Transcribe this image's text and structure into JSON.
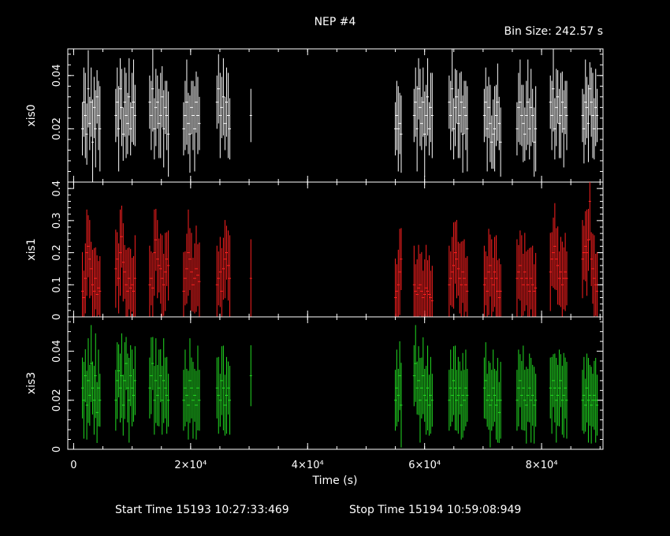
{
  "header": {
    "title": "NEP #4",
    "bin_size": "Bin Size: 242.57 s"
  },
  "footer": {
    "start_time": "Start Time 15193 10:27:33:469",
    "stop_time": "Stop Time 15194 10:59:08:949"
  },
  "colors": {
    "background": "#000000",
    "axes": "#ffffff",
    "xis0": "#ffffff",
    "xis1": "#ff2020",
    "xis3": "#22dd22"
  },
  "chart_data": {
    "type": "scatter",
    "style": "error-bar light curves, three stacked panels sharing x axis",
    "xlabel": "Time (s)",
    "xlim": [
      -1000,
      90500
    ],
    "x_ticks": [
      0,
      20000,
      40000,
      60000,
      80000
    ],
    "x_tick_labels": [
      "0",
      "2×10⁴",
      "4×10⁴",
      "6×10⁴",
      "8×10⁴"
    ],
    "panels": [
      {
        "name": "xis0",
        "ylabel": "xis0",
        "color": "#ffffff",
        "ylim": [
          0,
          0.05
        ],
        "y_ticks": [
          0.02,
          0.04
        ],
        "y_tick_labels": [
          "0.02",
          "0.04"
        ],
        "segments": [
          {
            "start": 1500,
            "end": 4500,
            "values": [
              0.02,
              0.03,
              0.025,
              0.018,
              0.035,
              0.022,
              0.03,
              0.015,
              0.028,
              0.02,
              0.032,
              0.025,
              0.02
            ]
          },
          {
            "start": 7200,
            "end": 10500,
            "values": [
              0.025,
              0.03,
              0.02,
              0.035,
              0.028,
              0.018,
              0.03,
              0.025,
              0.022,
              0.032,
              0.02,
              0.028,
              0.03,
              0.025
            ]
          },
          {
            "start": 13000,
            "end": 16200,
            "values": [
              0.03,
              0.025,
              0.035,
              0.02,
              0.028,
              0.03,
              0.022,
              0.025,
              0.032,
              0.02,
              0.028,
              0.025,
              0.018
            ]
          },
          {
            "start": 18800,
            "end": 21500,
            "values": [
              0.02,
              0.025,
              0.03,
              0.022,
              0.018,
              0.028,
              0.025,
              0.02,
              0.03,
              0.025,
              0.022
            ]
          },
          {
            "start": 24500,
            "end": 26700,
            "values": [
              0.03,
              0.035,
              0.025,
              0.028,
              0.032,
              0.022,
              0.03,
              0.025,
              0.02
            ]
          },
          {
            "start": 30300,
            "end": 30300,
            "values": [
              0.025
            ]
          },
          {
            "start": 55000,
            "end": 56000,
            "values": [
              0.02,
              0.025,
              0.02,
              0.022,
              0.018
            ]
          },
          {
            "start": 58200,
            "end": 61300,
            "values": [
              0.025,
              0.03,
              0.02,
              0.035,
              0.028,
              0.022,
              0.03,
              0.018,
              0.025,
              0.032,
              0.02,
              0.028,
              0.025
            ]
          },
          {
            "start": 64200,
            "end": 67300,
            "values": [
              0.03,
              0.025,
              0.035,
              0.02,
              0.028,
              0.032,
              0.022,
              0.025,
              0.03,
              0.018,
              0.028,
              0.025,
              0.02
            ]
          },
          {
            "start": 70200,
            "end": 73000,
            "values": [
              0.025,
              0.03,
              0.02,
              0.028,
              0.022,
              0.015,
              0.018,
              0.02,
              0.025,
              0.03,
              0.022,
              0.015
            ]
          },
          {
            "start": 75800,
            "end": 79000,
            "values": [
              0.02,
              0.028,
              0.03,
              0.025,
              0.022,
              0.018,
              0.025,
              0.03,
              0.02,
              0.028,
              0.025,
              0.015,
              0.02
            ]
          },
          {
            "start": 81500,
            "end": 84300,
            "values": [
              0.03,
              0.025,
              0.035,
              0.02,
              0.028,
              0.032,
              0.022,
              0.025,
              0.03,
              0.02,
              0.028,
              0.025
            ]
          },
          {
            "start": 87000,
            "end": 89500,
            "values": [
              0.025,
              0.02,
              0.03,
              0.028,
              0.022,
              0.035,
              0.03,
              0.025,
              0.02,
              0.028,
              0.025
            ]
          }
        ]
      },
      {
        "name": "xis1",
        "ylabel": "xis1",
        "color": "#ff2020",
        "ylim": [
          0,
          0.42
        ],
        "y_ticks": [
          0,
          0.1,
          0.2,
          0.3,
          0.4
        ],
        "y_tick_labels": [
          "0",
          "0.1",
          "0.2",
          "0.3",
          "0.4"
        ],
        "segments": [
          {
            "start": 1500,
            "end": 4500,
            "values": [
              0.08,
              0.06,
              0.12,
              0.2,
              0.22,
              0.18,
              0.15,
              0.1,
              0.08,
              0.12,
              0.07,
              0.09,
              0.08
            ]
          },
          {
            "start": 7200,
            "end": 10500,
            "values": [
              0.15,
              0.18,
              0.12,
              0.2,
              0.25,
              0.17,
              0.14,
              0.1,
              0.08,
              0.12,
              0.09,
              0.1,
              0.08,
              0.12
            ]
          },
          {
            "start": 13000,
            "end": 16200,
            "values": [
              0.1,
              0.12,
              0.09,
              0.2,
              0.24,
              0.18,
              0.16,
              0.15,
              0.12,
              0.1,
              0.14,
              0.18,
              0.16
            ]
          },
          {
            "start": 18800,
            "end": 21500,
            "values": [
              0.08,
              0.12,
              0.15,
              0.2,
              0.18,
              0.14,
              0.1,
              0.12,
              0.15,
              0.13,
              0.11
            ]
          },
          {
            "start": 24500,
            "end": 26700,
            "values": [
              0.1,
              0.12,
              0.14,
              0.08,
              0.15,
              0.18,
              0.2,
              0.16,
              0.12
            ]
          },
          {
            "start": 30300,
            "end": 30300,
            "values": [
              0.12
            ]
          },
          {
            "start": 55000,
            "end": 56000,
            "values": [
              0.06,
              0.08,
              0.1,
              0.14,
              0.18
            ]
          },
          {
            "start": 58200,
            "end": 61300,
            "values": [
              0.1,
              0.08,
              0.07,
              0.09,
              0.1,
              0.08,
              0.06,
              0.07,
              0.09,
              0.08,
              0.07,
              0.06,
              0.05
            ]
          },
          {
            "start": 64200,
            "end": 67300,
            "values": [
              0.1,
              0.12,
              0.14,
              0.16,
              0.2,
              0.18,
              0.15,
              0.12,
              0.1,
              0.14,
              0.12,
              0.1,
              0.08
            ]
          },
          {
            "start": 70200,
            "end": 73000,
            "values": [
              0.1,
              0.12,
              0.08,
              0.14,
              0.16,
              0.12,
              0.1,
              0.14,
              0.12,
              0.08,
              0.06,
              0.08
            ]
          },
          {
            "start": 75800,
            "end": 79000,
            "values": [
              0.12,
              0.14,
              0.16,
              0.12,
              0.1,
              0.14,
              0.12,
              0.1,
              0.08,
              0.12,
              0.1,
              0.08,
              0.09
            ]
          },
          {
            "start": 81500,
            "end": 84300,
            "values": [
              0.14,
              0.18,
              0.2,
              0.22,
              0.18,
              0.16,
              0.12,
              0.14,
              0.1,
              0.12,
              0.14,
              0.12
            ]
          },
          {
            "start": 87000,
            "end": 89500,
            "values": [
              0.18,
              0.2,
              0.22,
              0.2,
              0.24,
              0.36,
              0.18,
              0.15,
              0.12,
              0.1,
              0.08
            ]
          }
        ]
      },
      {
        "name": "xis3",
        "ylabel": "xis3",
        "color": "#22dd22",
        "ylim": [
          0,
          0.054
        ],
        "y_ticks": [
          0,
          0.02,
          0.04
        ],
        "y_tick_labels": [
          "0",
          "0.02",
          "0.04"
        ],
        "segments": [
          {
            "start": 1500,
            "end": 4500,
            "values": [
              0.025,
              0.02,
              0.03,
              0.018,
              0.028,
              0.022,
              0.035,
              0.025,
              0.02,
              0.03,
              0.015,
              0.025,
              0.02
            ]
          },
          {
            "start": 7200,
            "end": 10500,
            "values": [
              0.02,
              0.028,
              0.032,
              0.025,
              0.03,
              0.018,
              0.028,
              0.035,
              0.025,
              0.02,
              0.03,
              0.025,
              0.022,
              0.028
            ]
          },
          {
            "start": 13000,
            "end": 16200,
            "values": [
              0.025,
              0.03,
              0.035,
              0.02,
              0.028,
              0.022,
              0.025,
              0.03,
              0.02,
              0.028,
              0.025,
              0.022,
              0.02
            ]
          },
          {
            "start": 18800,
            "end": 21500,
            "values": [
              0.02,
              0.025,
              0.022,
              0.018,
              0.028,
              0.025,
              0.02,
              0.022,
              0.018,
              0.025,
              0.02
            ]
          },
          {
            "start": 24500,
            "end": 26700,
            "values": [
              0.025,
              0.022,
              0.02,
              0.028,
              0.025,
              0.018,
              0.022,
              0.025,
              0.02
            ]
          },
          {
            "start": 30300,
            "end": 30300,
            "values": [
              0.03
            ]
          },
          {
            "start": 55000,
            "end": 56000,
            "values": [
              0.02,
              0.025,
              0.022,
              0.03,
              0.018
            ]
          },
          {
            "start": 58200,
            "end": 61300,
            "values": [
              0.03,
              0.035,
              0.025,
              0.028,
              0.02,
              0.025,
              0.03,
              0.022,
              0.02,
              0.025,
              0.018,
              0.022,
              0.02
            ]
          },
          {
            "start": 64200,
            "end": 67300,
            "values": [
              0.02,
              0.025,
              0.022,
              0.028,
              0.025,
              0.02,
              0.022,
              0.025,
              0.018,
              0.022,
              0.02,
              0.025,
              0.022
            ]
          },
          {
            "start": 70200,
            "end": 73000,
            "values": [
              0.025,
              0.028,
              0.02,
              0.022,
              0.018,
              0.02,
              0.025,
              0.022,
              0.018,
              0.02,
              0.015,
              0.02
            ]
          },
          {
            "start": 75800,
            "end": 79000,
            "values": [
              0.02,
              0.025,
              0.028,
              0.022,
              0.025,
              0.02,
              0.018,
              0.022,
              0.025,
              0.02,
              0.022,
              0.018,
              0.02
            ]
          },
          {
            "start": 81500,
            "end": 84300,
            "values": [
              0.025,
              0.022,
              0.028,
              0.025,
              0.02,
              0.022,
              0.025,
              0.028,
              0.02,
              0.022,
              0.025,
              0.02
            ]
          },
          {
            "start": 87000,
            "end": 89500,
            "values": [
              0.02,
              0.022,
              0.018,
              0.025,
              0.02,
              0.022,
              0.018,
              0.02,
              0.022,
              0.02,
              0.018
            ]
          }
        ]
      }
    ]
  }
}
